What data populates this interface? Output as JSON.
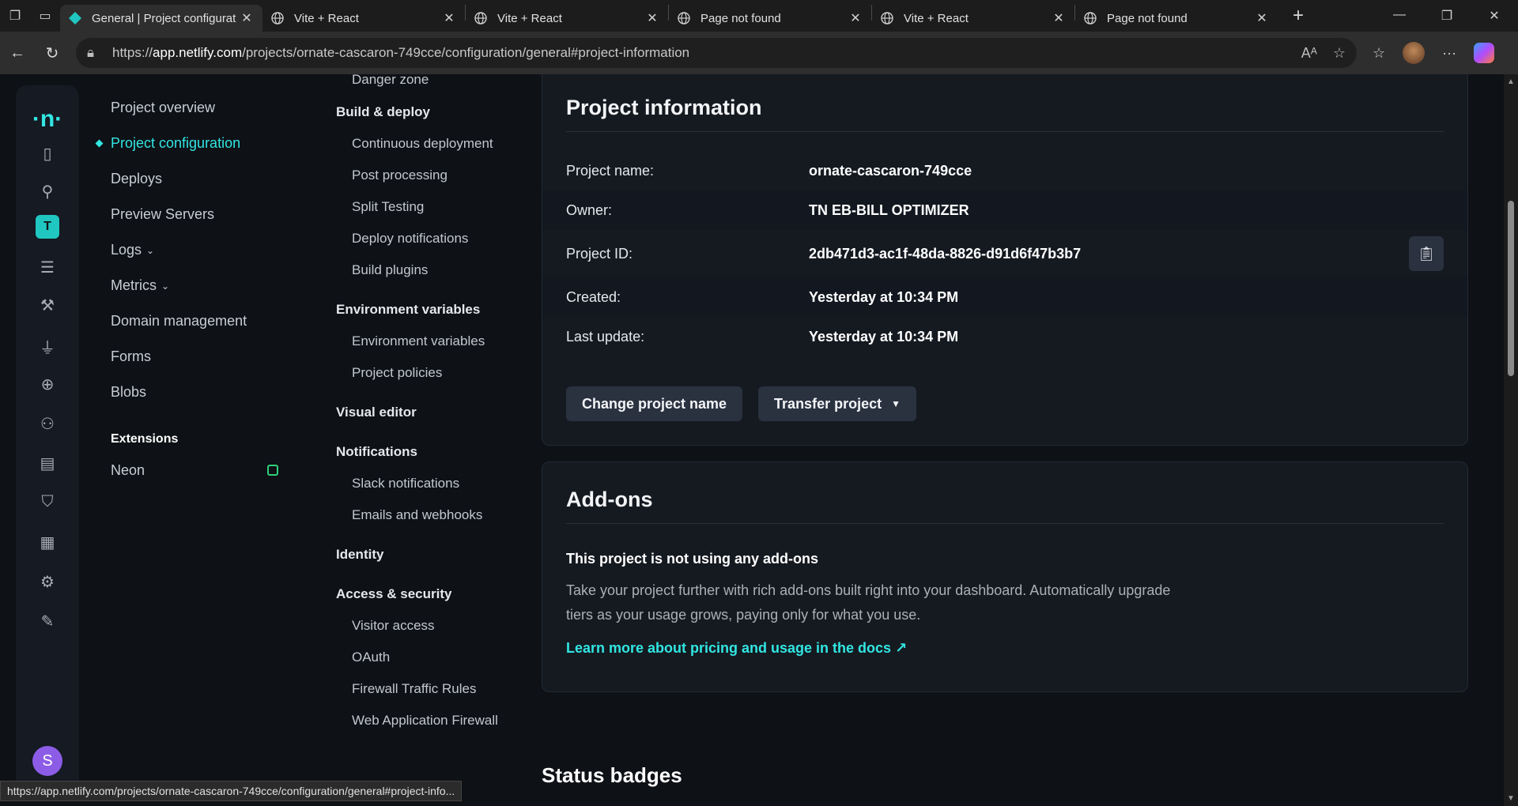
{
  "browser": {
    "tabs": [
      {
        "title": "General | Project configurat",
        "active": true,
        "favicon": "netlify-icon"
      },
      {
        "title": "Vite + React",
        "active": false,
        "favicon": "globe-icon"
      },
      {
        "title": "Vite + React",
        "active": false,
        "favicon": "globe-icon"
      },
      {
        "title": "Page not found",
        "active": false,
        "favicon": "globe-icon"
      },
      {
        "title": "Vite + React",
        "active": false,
        "favicon": "globe-icon"
      },
      {
        "title": "Page not found",
        "active": false,
        "favicon": "globe-icon"
      }
    ],
    "url_prefix": "https://",
    "url_host": "app.netlify.com",
    "url_path": "/projects/ornate-cascaron-749cce/configuration/general#project-information",
    "status_url": "https://app.netlify.com/projects/ornate-cascaron-749cce/configuration/general#project-info..."
  },
  "rail": {
    "team_initial": "T",
    "user_initial": "S"
  },
  "main_nav": {
    "items": [
      {
        "label": "Project overview",
        "active": false
      },
      {
        "label": "Project configuration",
        "active": true
      },
      {
        "label": "Deploys",
        "active": false
      },
      {
        "label": "Preview Servers",
        "active": false
      },
      {
        "label": "Logs",
        "active": false,
        "caret": true
      },
      {
        "label": "Metrics",
        "active": false,
        "caret": true
      },
      {
        "label": "Domain management",
        "active": false
      },
      {
        "label": "Forms",
        "active": false
      },
      {
        "label": "Blobs",
        "active": false
      }
    ],
    "extensions_heading": "Extensions",
    "extensions": [
      {
        "label": "Neon"
      }
    ]
  },
  "sub_nav": {
    "danger_zone": "Danger zone",
    "groups": [
      {
        "label": "Build & deploy",
        "links": [
          "Continuous deployment",
          "Post processing",
          "Split Testing",
          "Deploy notifications",
          "Build plugins"
        ]
      },
      {
        "label": "Environment variables",
        "links": [
          "Environment variables",
          "Project policies"
        ]
      },
      {
        "label": "Visual editor",
        "links": []
      },
      {
        "label": "Notifications",
        "links": [
          "Slack notifications",
          "Emails and webhooks"
        ]
      },
      {
        "label": "Identity",
        "links": []
      },
      {
        "label": "Access & security",
        "links": [
          "Visitor access",
          "OAuth",
          "Firewall Traffic Rules",
          "Web Application Firewall"
        ]
      }
    ]
  },
  "project_info": {
    "title": "Project information",
    "rows": [
      {
        "label": "Project name:",
        "value": "ornate-cascaron-749cce"
      },
      {
        "label": "Owner:",
        "value": "TN EB-BILL OPTIMIZER"
      },
      {
        "label": "Project ID:",
        "value": "2db471d3-ac1f-48da-8826-d91d6f47b3b7"
      },
      {
        "label": "Created:",
        "value": "Yesterday at 10:34 PM"
      },
      {
        "label": "Last update:",
        "value": "Yesterday at 10:34 PM"
      }
    ],
    "change_name_button": "Change project name",
    "transfer_button": "Transfer project"
  },
  "addons": {
    "title": "Add-ons",
    "empty_title": "This project is not using any add-ons",
    "description": "Take your project further with rich add-ons built right into your dashboard. Automatically upgrade tiers as your usage grows, paying only for what you use.",
    "docs_link": "Learn more about pricing and usage in the docs ↗"
  },
  "status_badges": {
    "title": "Status badges"
  },
  "colors": {
    "accent": "#32e6e2",
    "background": "#0e1116",
    "card": "#151a21"
  }
}
